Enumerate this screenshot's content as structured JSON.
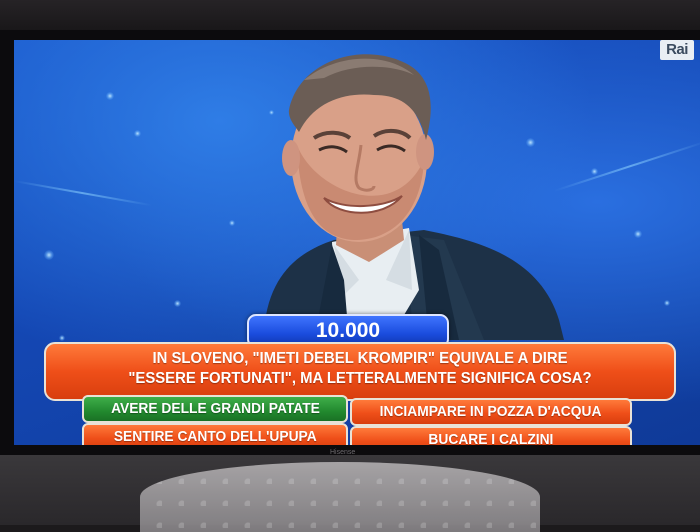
{
  "channel_logo": "Rai",
  "tv_brand": "Hisense",
  "amount": "10.000",
  "question": {
    "line1": "IN SLOVENO, \"IMETI DEBEL KROMPIR\" EQUIVALE A DIRE",
    "line2": "\"ESSERE FORTUNATI\", MA LETTERALMENTE SIGNIFICA COSA?"
  },
  "answers": [
    {
      "label": "AVERE DELLE GRANDI PATATE",
      "state": "correct"
    },
    {
      "label": "INCIAMPARE IN POZZA D'ACQUA",
      "state": "default"
    },
    {
      "label": "SENTIRE CANTO DELL'UPUPA",
      "state": "default"
    },
    {
      "label": "BUCARE I CALZINI",
      "state": "default"
    }
  ],
  "colors": {
    "backdrop_blue": "#1854c8",
    "question_orange": "#ef4f19",
    "correct_green": "#22892e",
    "amount_blue": "#1a4cdd"
  }
}
